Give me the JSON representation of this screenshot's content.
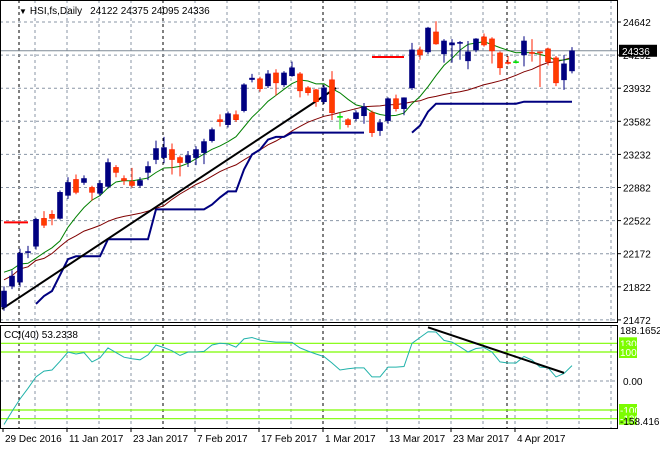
{
  "chart_data": {
    "type": "candlestick",
    "title": {
      "arrow": "▼",
      "symbol": "HSI,fs,Daily",
      "ohlc_text": "24122 24375 24095 24336"
    },
    "ohlc": [
      [
        21610,
        21830,
        21570,
        21780
      ],
      [
        21833,
        22000,
        21800,
        21939
      ],
      [
        21875,
        22230,
        21830,
        22183
      ],
      [
        22190,
        22260,
        22130,
        22200
      ],
      [
        22257,
        22560,
        22220,
        22543
      ],
      [
        22553,
        22630,
        22450,
        22480
      ],
      [
        22596,
        22640,
        22480,
        22553
      ],
      [
        22553,
        22850,
        22540,
        22830
      ],
      [
        22798,
        22990,
        22760,
        22935
      ],
      [
        22967,
        23020,
        22810,
        22830
      ],
      [
        22935,
        23010,
        22910,
        22977
      ],
      [
        22882,
        22900,
        22740,
        22830
      ],
      [
        22820,
        22960,
        22790,
        22925
      ],
      [
        22893,
        23190,
        22870,
        23147
      ],
      [
        23095,
        23120,
        22990,
        23042
      ],
      [
        22977,
        23010,
        22910,
        22956
      ],
      [
        22945,
        23090,
        22880,
        22903
      ],
      [
        22903,
        22990,
        22880,
        22956
      ],
      [
        23042,
        23160,
        22960,
        23105
      ],
      [
        23179,
        23380,
        23130,
        23296
      ],
      [
        23200,
        23420,
        23140,
        23306
      ],
      [
        23285,
        23350,
        23020,
        23179
      ],
      [
        23200,
        23220,
        23000,
        23147
      ],
      [
        23147,
        23270,
        23100,
        23222
      ],
      [
        23200,
        23320,
        23120,
        23285
      ],
      [
        23253,
        23400,
        23130,
        23370
      ],
      [
        23380,
        23520,
        23360,
        23497
      ],
      [
        23603,
        23660,
        23530,
        23582
      ],
      [
        23550,
        23690,
        23520,
        23667
      ],
      [
        23656,
        23700,
        23580,
        23603
      ],
      [
        23699,
        23990,
        23680,
        23974
      ],
      [
        24030,
        24090,
        24000,
        24045
      ],
      [
        24037,
        24060,
        23900,
        23932
      ],
      [
        23963,
        24130,
        23940,
        24090
      ],
      [
        24100,
        24140,
        23860,
        23995
      ],
      [
        23974,
        24120,
        23950,
        24100
      ],
      [
        24070,
        24220,
        24060,
        24155
      ],
      [
        24090,
        24110,
        23840,
        23910
      ],
      [
        23942,
        23960,
        23860,
        23890
      ],
      [
        23921,
        23930,
        23740,
        23794
      ],
      [
        23794,
        23970,
        23770,
        23942
      ],
      [
        24027,
        24120,
        23600,
        23677
      ],
      [
        23638,
        23680,
        23500,
        23638
      ],
      [
        23603,
        23620,
        23520,
        23550
      ],
      [
        23614,
        23700,
        23590,
        23677
      ],
      [
        23645,
        23780,
        23560,
        23740
      ],
      [
        23677,
        23700,
        23420,
        23465
      ],
      [
        23487,
        23610,
        23430,
        23572
      ],
      [
        23593,
        23840,
        23560,
        23826
      ],
      [
        23826,
        23870,
        23690,
        23720
      ],
      [
        23720,
        23840,
        23650,
        23836
      ],
      [
        23942,
        24420,
        23920,
        24345
      ],
      [
        24345,
        24380,
        24240,
        24292
      ],
      [
        24324,
        24590,
        24300,
        24578
      ],
      [
        24536,
        24650,
        24400,
        24409
      ],
      [
        24303,
        24460,
        24210,
        24440
      ],
      [
        24398,
        24460,
        24210,
        24420
      ],
      [
        24415,
        24440,
        24240,
        24425
      ],
      [
        24229,
        24440,
        24140,
        24324
      ],
      [
        24345,
        24470,
        24320,
        24462
      ],
      [
        24483,
        24520,
        24380,
        24398
      ],
      [
        24462,
        24480,
        24200,
        24335
      ],
      [
        24313,
        24330,
        24080,
        24155
      ],
      [
        24212,
        24280,
        24190,
        24205
      ],
      [
        24220,
        24240,
        24200,
        24220
      ],
      [
        24292,
        24490,
        24170,
        24440
      ],
      [
        24318,
        24460,
        24220,
        24310
      ],
      [
        24324,
        24330,
        23950,
        24313
      ],
      [
        24356,
        24370,
        24180,
        24218
      ],
      [
        24260,
        24280,
        23960,
        23995
      ],
      [
        24027,
        24290,
        23920,
        24197
      ],
      [
        24122,
        24375,
        24095,
        24336
      ]
    ],
    "support_line": [
      null,
      null,
      null,
      null,
      21643,
      21727,
      21780,
      21950,
      22119,
      22150,
      22150,
      22150,
      22150,
      22331,
      22331,
      22331,
      22331,
      22331,
      22331,
      22649,
      22649,
      22649,
      22649,
      22649,
      22649,
      22649,
      22700,
      22776,
      22840,
      22840,
      23073,
      23232,
      23285,
      23391,
      23420,
      23420,
      23465,
      23465,
      23465,
      23465,
      23465,
      23465,
      23465,
      23465,
      23465,
      23465,
      null,
      null,
      null,
      null,
      null,
      23465,
      23540,
      23688,
      23773,
      23773,
      23773,
      23773,
      23773,
      23773,
      23773,
      23773,
      23773,
      23773,
      23773,
      23794,
      23794,
      23794,
      23794,
      23794,
      23794,
      23794
    ],
    "price_levels": [
      {
        "value": 22510,
        "from_bar": 0,
        "to_bar": 3
      },
      {
        "value": 24270,
        "from_bar": 46,
        "to_bar": 50
      }
    ],
    "trendline": {
      "from_bar": 0,
      "from_value": 21590,
      "to_bar": 41,
      "to_value": 23940
    },
    "price_axis": {
      "ticks": [
        "24642",
        "24292",
        "23932",
        "23582",
        "23232",
        "22882",
        "22522",
        "22172",
        "21822",
        "21472"
      ],
      "ylim": [
        21472,
        24642
      ],
      "current_price": "24336"
    },
    "date_axis": [
      {
        "bar": 0,
        "label": "29 Dec 2016"
      },
      {
        "bar": 8,
        "label": "11 Jan 2017"
      },
      {
        "bar": 16,
        "label": "23 Jan 2017"
      },
      {
        "bar": 24,
        "label": "7 Feb 2017"
      },
      {
        "bar": 32,
        "label": "17 Feb 2017"
      },
      {
        "bar": 40,
        "label": "1 Mar 2017"
      },
      {
        "bar": 48,
        "label": "13 Mar 2017"
      },
      {
        "bar": 56,
        "label": "23 Mar 2017"
      },
      {
        "bar": 64,
        "label": "4 Apr 2017"
      }
    ],
    "month_separators": [
      2,
      20,
      40,
      63
    ],
    "cci": {
      "label": "CCI(40) 53.2338",
      "ylim": [
        -158.416,
        188.1652
      ],
      "max_label": "188.1652",
      "min_label": "-158.416",
      "zero_label": "0.00",
      "levels": [
        {
          "value": 130,
          "label": "130"
        },
        {
          "value": 100,
          "label": "100"
        },
        {
          "value": -100,
          "label": "-100"
        },
        {
          "value": -130,
          "label": "-130"
        }
      ],
      "values": [
        -150,
        -105,
        -62,
        -25,
        14,
        34,
        38,
        68,
        100,
        93,
        98,
        66,
        80,
        114,
        98,
        82,
        77,
        73,
        90,
        124,
        115,
        104,
        88,
        100,
        100,
        102,
        124,
        130,
        128,
        117,
        145,
        150,
        141,
        137,
        134,
        134,
        133,
        114,
        103,
        93,
        84,
        62,
        38,
        42,
        45,
        45,
        14,
        14,
        48,
        48,
        50,
        130,
        150,
        170,
        169,
        140,
        134,
        118,
        100,
        112,
        115,
        100,
        66,
        62,
        62,
        85,
        72,
        48,
        46,
        14,
        26,
        53.2338
      ],
      "trendline": {
        "from_bar": 53,
        "from_value": 185,
        "to_bar": 70,
        "to_value": 28
      }
    },
    "colors": {
      "bull": "#000080",
      "bear": "#ff3c00",
      "doji": "#00e000",
      "fast_ma": "#008000",
      "slow_ma": "#800000",
      "support": "#000080",
      "level": "#ff0000",
      "cci_line": "#20b2aa",
      "cci_level": "#7cfc00"
    }
  }
}
